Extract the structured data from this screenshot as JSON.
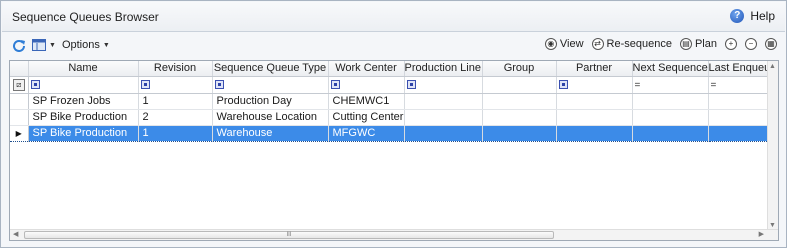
{
  "window": {
    "title": "Sequence Queues Browser",
    "help_label": "Help"
  },
  "toolbar": {
    "options_label": "Options",
    "view_label": "View",
    "resequence_label": "Re-sequence",
    "plan_label": "Plan"
  },
  "grid": {
    "columns": [
      "Name",
      "Revision",
      "Sequence Queue Type",
      "Work Center",
      "Production Line N",
      "Group",
      "Partner",
      "Next Sequence",
      "Last Enqueue Seq"
    ],
    "filters": [
      "",
      "",
      "",
      "",
      "",
      "",
      "",
      "=",
      "="
    ],
    "rows": [
      [
        "SP Frozen Jobs",
        "1",
        "Production Day",
        "CHEMWC1",
        "",
        "",
        "",
        "",
        ""
      ],
      [
        "SP Bike Production",
        "2",
        "Warehouse Location",
        "Cutting Center",
        "",
        "",
        "",
        "",
        ""
      ],
      [
        "SP Bike Production",
        "1",
        "Warehouse",
        "MFGWC",
        "",
        "",
        "",
        "",
        ""
      ]
    ],
    "selected_row": 2,
    "scroll_mark": "III"
  },
  "colors": {
    "selection": "#3c8be8",
    "filter_icon": "#3a4fb0"
  }
}
